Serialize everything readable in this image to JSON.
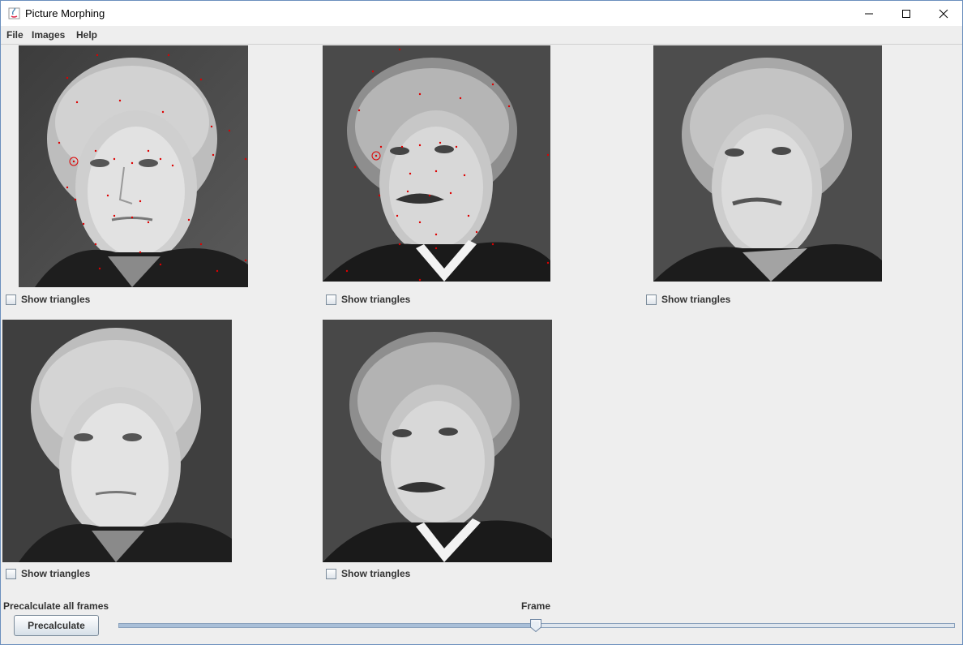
{
  "window": {
    "title": "Picture Morphing"
  },
  "menu": [
    {
      "label": "File"
    },
    {
      "label": "Images"
    },
    {
      "label": "Help"
    }
  ],
  "panels": [
    {
      "checkbox_label": "Show triangles",
      "checked": false
    },
    {
      "checkbox_label": "Show triangles",
      "checked": false
    },
    {
      "checkbox_label": "Show triangles",
      "checked": false
    },
    {
      "checkbox_label": "Show triangles",
      "checked": false
    },
    {
      "checkbox_label": "Show triangles",
      "checked": false
    }
  ],
  "controls": {
    "precalc_label": "Precalculate all frames",
    "precalc_button": "Precalculate",
    "frame_label": "Frame",
    "frame_fraction": 0.5
  },
  "colors": {
    "control_point": "#dd0000",
    "accent": "#6b8fbd"
  }
}
